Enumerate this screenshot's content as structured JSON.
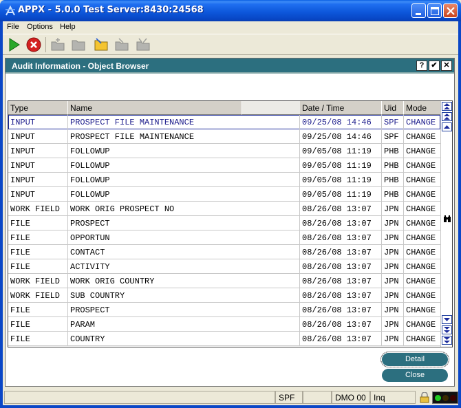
{
  "window": {
    "title": "APPX - 5.0.0 Test Server:8430:24568"
  },
  "menu": {
    "file": "File",
    "options": "Options",
    "help": "Help"
  },
  "toolbar": {
    "icons": [
      "play-icon",
      "stop-icon",
      "new-folder-icon",
      "folder-icon",
      "open-folder-icon",
      "folder-disabled-icon",
      "folder-disabled-icon"
    ]
  },
  "dialog": {
    "title": "Audit Information - Object Browser",
    "help_label": "?",
    "ok_label": "✔",
    "close_label": "✕"
  },
  "grid": {
    "columns": [
      "Type",
      "Name",
      "Date / Time",
      "Uid",
      "Mode"
    ],
    "rows": [
      {
        "type": "INPUT",
        "name": "PROSPECT FILE MAINTENANCE",
        "datetime": "09/25/08  14:46",
        "uid": "SPF",
        "mode": "CHANGE"
      },
      {
        "type": "INPUT",
        "name": "PROSPECT FILE MAINTENANCE",
        "datetime": "09/25/08  14:46",
        "uid": "SPF",
        "mode": "CHANGE"
      },
      {
        "type": "INPUT",
        "name": "FOLLOWUP",
        "datetime": "09/05/08  11:19",
        "uid": "PHB",
        "mode": "CHANGE"
      },
      {
        "type": "INPUT",
        "name": "FOLLOWUP",
        "datetime": "09/05/08  11:19",
        "uid": "PHB",
        "mode": "CHANGE"
      },
      {
        "type": "INPUT",
        "name": "FOLLOWUP",
        "datetime": "09/05/08  11:19",
        "uid": "PHB",
        "mode": "CHANGE"
      },
      {
        "type": "INPUT",
        "name": "FOLLOWUP",
        "datetime": "09/05/08  11:19",
        "uid": "PHB",
        "mode": "CHANGE"
      },
      {
        "type": "WORK FIELD",
        "name": "WORK ORIG PROSPECT NO",
        "datetime": "08/26/08  13:07",
        "uid": "JPN",
        "mode": "CHANGE"
      },
      {
        "type": "FILE",
        "name": "PROSPECT",
        "datetime": "08/26/08  13:07",
        "uid": "JPN",
        "mode": "CHANGE"
      },
      {
        "type": "FILE",
        "name": "OPPORTUN",
        "datetime": "08/26/08  13:07",
        "uid": "JPN",
        "mode": "CHANGE"
      },
      {
        "type": "FILE",
        "name": "CONTACT",
        "datetime": "08/26/08  13:07",
        "uid": "JPN",
        "mode": "CHANGE"
      },
      {
        "type": "FILE",
        "name": "ACTIVITY",
        "datetime": "08/26/08  13:07",
        "uid": "JPN",
        "mode": "CHANGE"
      },
      {
        "type": "WORK FIELD",
        "name": "WORK ORIG COUNTRY",
        "datetime": "08/26/08  13:07",
        "uid": "JPN",
        "mode": "CHANGE"
      },
      {
        "type": "WORK FIELD",
        "name": "SUB COUNTRY",
        "datetime": "08/26/08  13:07",
        "uid": "JPN",
        "mode": "CHANGE"
      },
      {
        "type": "FILE",
        "name": "PROSPECT",
        "datetime": "08/26/08  13:07",
        "uid": "JPN",
        "mode": "CHANGE"
      },
      {
        "type": "FILE",
        "name": "PARAM",
        "datetime": "08/26/08  13:07",
        "uid": "JPN",
        "mode": "CHANGE"
      },
      {
        "type": "FILE",
        "name": "COUNTRY",
        "datetime": "08/26/08  13:07",
        "uid": "JPN",
        "mode": "CHANGE"
      }
    ],
    "selected_row": 0
  },
  "actions": {
    "detail": "Detail",
    "close": "Close"
  },
  "status": {
    "user": "SPF",
    "blank": "",
    "database": "DMO 00",
    "mode": "Inq"
  },
  "colors": {
    "titlebar": "#0a55d9",
    "dialog_title": "#2c6f7f",
    "selected_text": "#1c1c8c"
  }
}
